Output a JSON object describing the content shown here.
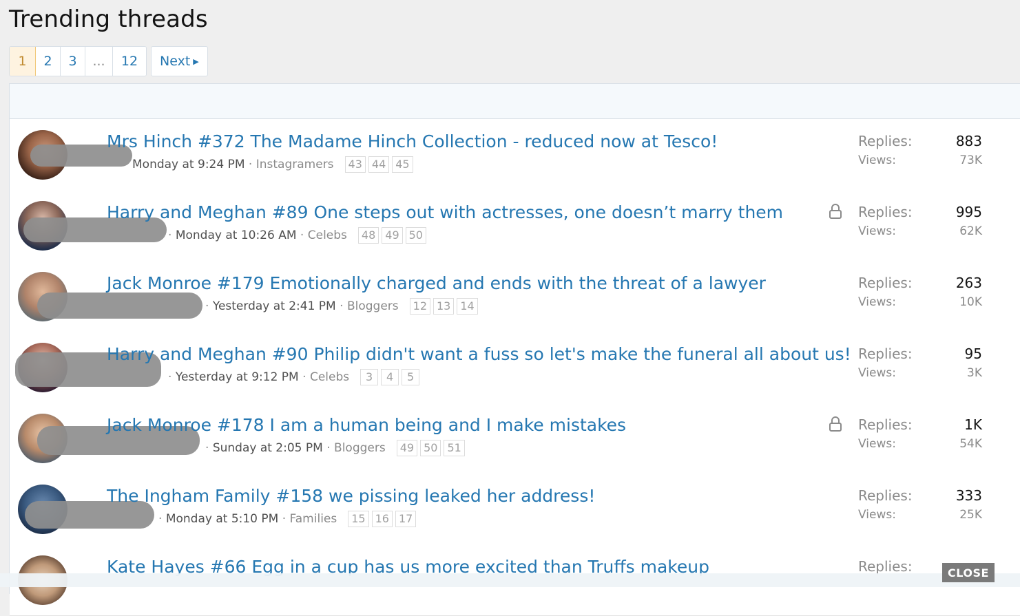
{
  "page_title": "Trending threads",
  "pagination": {
    "pages": [
      "1",
      "2",
      "3",
      "...",
      "12"
    ],
    "current": "1",
    "next_label": "Next"
  },
  "threads": [
    {
      "title": "Mrs Hinch #372 The Madame Hinch Collection - reduced now at Tesco!",
      "date": "Monday at 9:24 PM",
      "forum": "Instagramers",
      "pages": [
        "43",
        "44",
        "45"
      ],
      "locked": false,
      "replies_label": "Replies:",
      "replies": "883",
      "views_label": "Views:",
      "views": "73K"
    },
    {
      "title": "Harry and Meghan #89 One steps out with actresses, one doesn’t marry them",
      "date": "Monday at 10:26 AM",
      "forum": "Celebs",
      "pages": [
        "48",
        "49",
        "50"
      ],
      "locked": true,
      "replies_label": "Replies:",
      "replies": "995",
      "views_label": "Views:",
      "views": "62K"
    },
    {
      "title": "Jack Monroe #179 Emotionally charged and ends with the threat of a lawyer",
      "date": "Yesterday at 2:41 PM",
      "forum": "Bloggers",
      "pages": [
        "12",
        "13",
        "14"
      ],
      "locked": false,
      "replies_label": "Replies:",
      "replies": "263",
      "views_label": "Views:",
      "views": "10K"
    },
    {
      "title": "Harry and Meghan #90 Philip didn't want a fuss so let's make the funeral all about us!",
      "date": "Yesterday at 9:12 PM",
      "forum": "Celebs",
      "pages": [
        "3",
        "4",
        "5"
      ],
      "locked": false,
      "replies_label": "Replies:",
      "replies": "95",
      "views_label": "Views:",
      "views": "3K"
    },
    {
      "title": "Jack Monroe #178 I am a human being and I make mistakes",
      "date": "Sunday at 2:05 PM",
      "forum": "Bloggers",
      "pages": [
        "49",
        "50",
        "51"
      ],
      "locked": true,
      "replies_label": "Replies:",
      "replies": "1K",
      "views_label": "Views:",
      "views": "54K"
    },
    {
      "title": "The Ingham Family #158 we pissing leaked her address!",
      "date": "Monday at 5:10 PM",
      "forum": "Families",
      "pages": [
        "15",
        "16",
        "17"
      ],
      "locked": false,
      "replies_label": "Replies:",
      "replies": "333",
      "views_label": "Views:",
      "views": "25K"
    },
    {
      "title": "Kate Hayes #66 Egg in a cup has us more excited than Truffs makeup",
      "date": "",
      "forum": "",
      "pages": [],
      "locked": false,
      "replies_label": "Replies:",
      "replies": "",
      "views_label": "",
      "views": ""
    }
  ],
  "close_label": "CLOSE",
  "colors": {
    "link": "#2577b1",
    "muted": "#8a8a8a",
    "current_page_bg": "#fef3e0"
  }
}
